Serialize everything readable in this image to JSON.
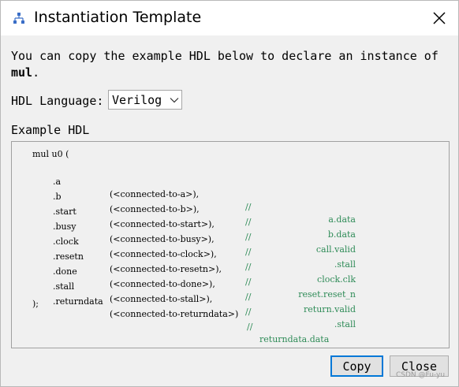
{
  "window": {
    "title": "Instantiation Template",
    "close_icon": "close-icon",
    "app_icon": "network-icon"
  },
  "description": {
    "prefix": "You can copy the example HDL below to declare an instance of",
    "module_name": "mul",
    "suffix": "."
  },
  "hdl_language": {
    "label": "HDL Language:",
    "selected": "Verilog"
  },
  "example": {
    "label": "Example HDL",
    "header": "mul u0 (",
    "ports": [
      {
        "port": ".a",
        "conn": "(<connected-to-a>),",
        "slash": "//",
        "comment": "a.data"
      },
      {
        "port": ".b",
        "conn": "(<connected-to-b>),",
        "slash": "//",
        "comment": "b.data"
      },
      {
        "port": ".start",
        "conn": "(<connected-to-start>),",
        "slash": "//",
        "comment": "call.valid"
      },
      {
        "port": ".busy",
        "conn": "(<connected-to-busy>),",
        "slash": "//",
        "comment": ".stall"
      },
      {
        "port": ".clock",
        "conn": "(<connected-to-clock>),",
        "slash": "//",
        "comment": "clock.clk"
      },
      {
        "port": ".resetn",
        "conn": "(<connected-to-resetn>),",
        "slash": "//",
        "comment": "reset.reset_n"
      },
      {
        "port": ".done",
        "conn": "(<connected-to-done>),",
        "slash": "//",
        "comment": "return.valid"
      },
      {
        "port": ".stall",
        "conn": "(<connected-to-stall>),",
        "slash": "//",
        "comment": ".stall"
      }
    ],
    "last_port": {
      "port": ".returndata",
      "conn": "(<connected-to-returndata>)",
      "slash": "//",
      "comment": "returndata.data"
    },
    "footer": ");"
  },
  "buttons": {
    "copy": "Copy",
    "close": "Close"
  },
  "watermark": "CSDN @Fu-yu",
  "colors": {
    "comment": "#2e8b57",
    "focus_border": "#0078d7",
    "dialog_bg": "#f0f0f0"
  }
}
